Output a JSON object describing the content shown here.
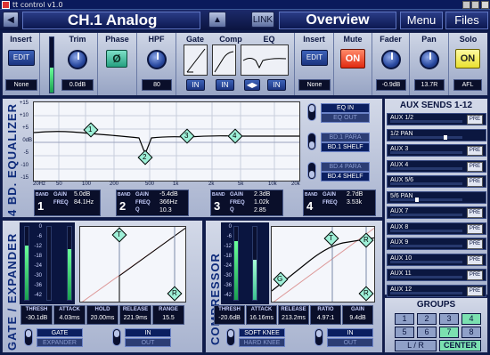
{
  "window": {
    "title": "tt control  v1.0"
  },
  "nav": {
    "channel_name": "CH.1 Analog",
    "link_label": "LINK",
    "view_name": "Overview",
    "menu_label": "Menu",
    "files_label": "Files"
  },
  "strip": {
    "insert1": {
      "label": "Insert",
      "edit": "EDIT",
      "value": "None"
    },
    "trim": {
      "label": "Trim",
      "value": "0.0dB"
    },
    "phase": {
      "label": "Phase",
      "symbol": "Ø"
    },
    "hpf": {
      "label": "HPF",
      "value": "80"
    },
    "gate": {
      "label": "Gate",
      "in": "IN"
    },
    "comp": {
      "label": "Comp",
      "in": "IN"
    },
    "eq": {
      "label": "EQ",
      "in": "IN"
    },
    "insert2": {
      "label": "Insert",
      "edit": "EDIT",
      "value": "None"
    },
    "mute": {
      "label": "Mute",
      "on": "ON"
    },
    "fader": {
      "label": "Fader",
      "value": "-0.9dB"
    },
    "pan": {
      "label": "Pan",
      "value": "13.7R"
    },
    "solo": {
      "label": "Solo",
      "on": "ON",
      "mode": "AFL"
    }
  },
  "eq": {
    "title": "4 BD. EQUALIZER",
    "y_ticks": [
      "+15",
      "+10",
      "+5",
      "0dB",
      "-5",
      "-10",
      "-15"
    ],
    "x_ticks": [
      "20Hz",
      "50",
      "100",
      "200",
      "500",
      "1k",
      "2k",
      "5k",
      "10k",
      "20k"
    ],
    "eq_in": "EQ IN",
    "eq_out": "EQ OUT",
    "bd1_para": "BD.1 PARA",
    "bd1_shelf": "BD.1 SHELF",
    "bd4_para": "BD.4 PARA",
    "bd4_shelf": "BD.4 SHELF",
    "bands": [
      {
        "num": "1",
        "band": "BAND",
        "gain_label": "GAIN",
        "freq_label": "FREQ",
        "gain": "5.0dB",
        "freq": "84.1Hz",
        "q_label": "",
        "q": ""
      },
      {
        "num": "2",
        "band": "BAND",
        "gain_label": "GAIN",
        "freq_label": "FREQ",
        "gain": "-5.4dB",
        "freq": "366Hz",
        "q_label": "Q",
        "q": "10.3"
      },
      {
        "num": "3",
        "band": "BAND",
        "gain_label": "GAIN",
        "freq_label": "FREQ",
        "gain": "2.3dB",
        "freq": "1.02k",
        "q_label": "Q",
        "q": "2.85"
      },
      {
        "num": "4",
        "band": "BAND",
        "gain_label": "GAIN",
        "freq_label": "FREQ",
        "gain": "2.7dB",
        "freq": "3.53k",
        "q_label": "",
        "q": ""
      }
    ]
  },
  "aux": {
    "title": "AUX SENDS 1-12",
    "pre": "PRE",
    "items": [
      {
        "label": "AUX 1/2"
      },
      {
        "label": "1/2 PAN"
      },
      {
        "label": "AUX 3"
      },
      {
        "label": "AUX 4"
      },
      {
        "label": "AUX 5/6"
      },
      {
        "label": "5/6 PAN"
      },
      {
        "label": "AUX 7"
      },
      {
        "label": "AUX 8"
      },
      {
        "label": "AUX 9"
      },
      {
        "label": "AUX 10"
      },
      {
        "label": "AUX 11"
      },
      {
        "label": "AUX 12"
      }
    ]
  },
  "groups": {
    "title": "GROUPS",
    "buttons": [
      "1",
      "2",
      "3",
      "4",
      "5",
      "6",
      "7",
      "8"
    ],
    "lr": "L / R",
    "center": "CENTER"
  },
  "gate": {
    "title": "GATE / EXPANDER",
    "scale": [
      "0",
      "-6",
      "-12",
      "-18",
      "-24",
      "-30",
      "-36",
      "-42"
    ],
    "params": [
      {
        "label": "THRESH",
        "value": "-30.1dB"
      },
      {
        "label": "ATTACK",
        "value": "4.03ms"
      },
      {
        "label": "HOLD",
        "value": "20.00ms"
      },
      {
        "label": "RELEASE",
        "value": "221.9ms"
      },
      {
        "label": "RANGE",
        "value": "15.5"
      }
    ],
    "mode_on": "GATE",
    "mode_off": "EXPANDER",
    "in": "IN",
    "out": "OUT",
    "marker_t": "T",
    "marker_r": "R"
  },
  "comp": {
    "title": "COMPRESSOR",
    "scale": [
      "0",
      "-6",
      "-12",
      "-18",
      "-24",
      "-30",
      "-36",
      "-42"
    ],
    "params": [
      {
        "label": "THRESH",
        "value": "-20.6dB"
      },
      {
        "label": "ATTACK",
        "value": "16.16ms"
      },
      {
        "label": "RELEASE",
        "value": "213.2ms"
      },
      {
        "label": "RATIO",
        "value": "4.97:1"
      },
      {
        "label": "GAIN",
        "value": "9.4dB"
      }
    ],
    "knee_on": "SOFT KNEE",
    "knee_off": "HARD KNEE",
    "in": "IN",
    "out": "OUT",
    "marker_t": "T",
    "marker_r": "R",
    "marker_g": "G"
  }
}
